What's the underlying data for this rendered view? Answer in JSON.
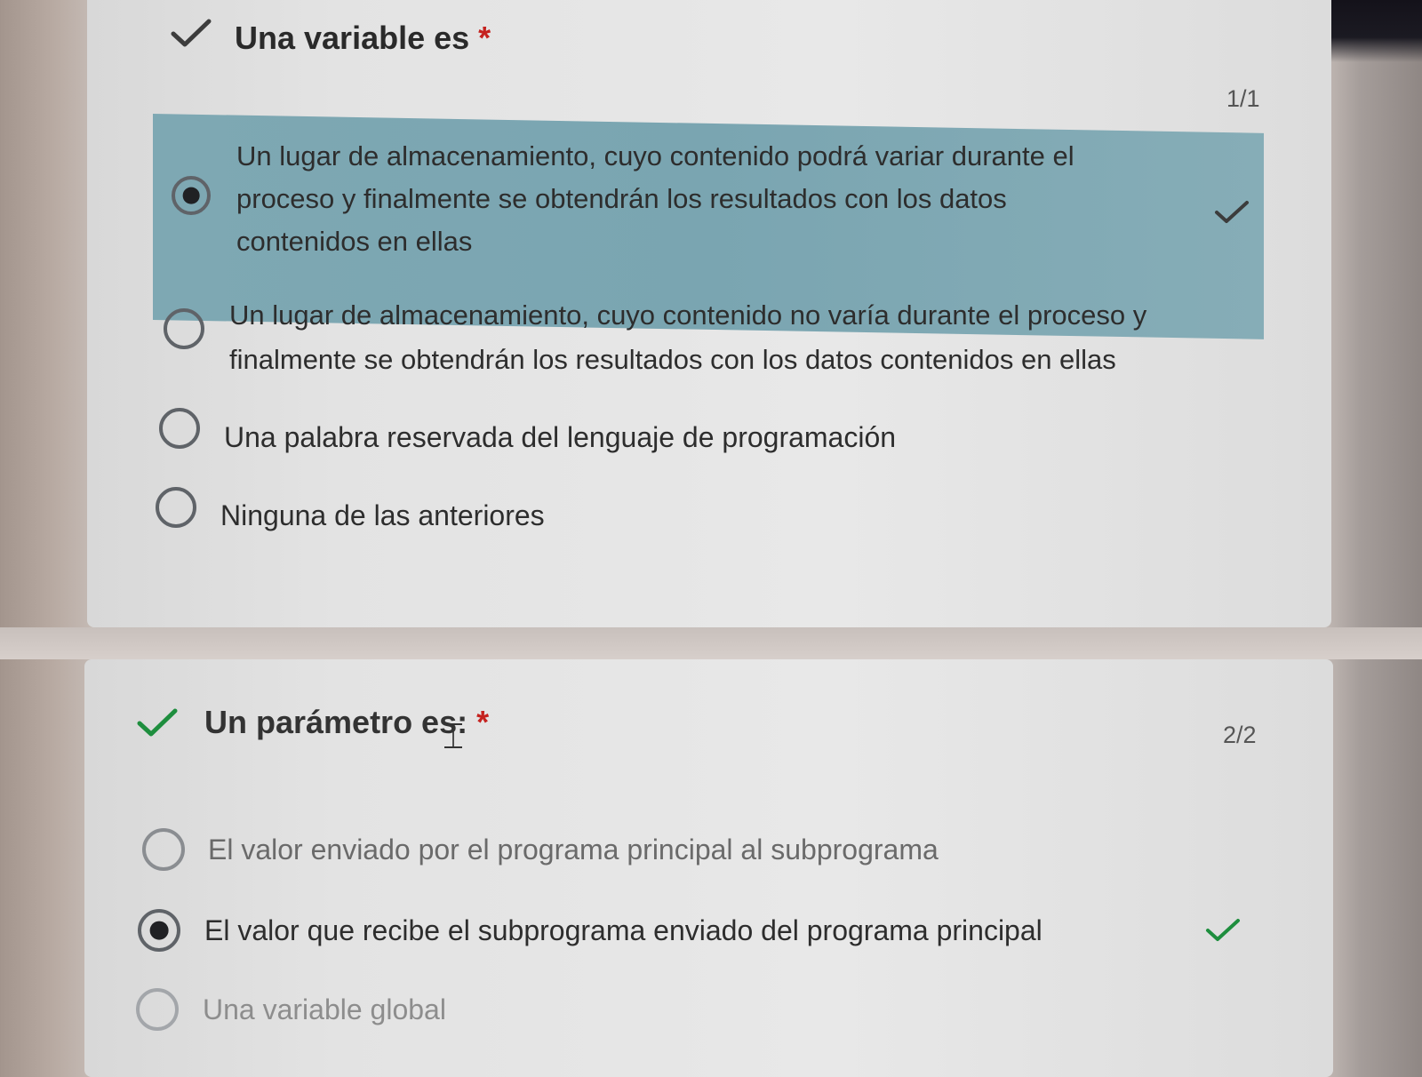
{
  "questions": [
    {
      "title": "Una variable es",
      "required_mark": "*",
      "score": "1/1",
      "options": [
        {
          "line1": "Un lugar de almacenamiento, cuyo contenido podrá variar durante el",
          "line2": "proceso y finalmente se obtendrán los resultados con los datos",
          "line3": "contenidos en ellas",
          "selected": true,
          "correct": true
        },
        {
          "line1": "Un lugar de almacenamiento, cuyo contenido no varía durante el proceso y",
          "line2": "finalmente se obtendrán los resultados con los datos contenidos en ellas",
          "selected": false
        },
        {
          "line1": "Una palabra reservada del lenguaje de programación",
          "selected": false
        },
        {
          "line1": "Ninguna de las anteriores",
          "selected": false
        }
      ]
    },
    {
      "title": "Un parámetro es:",
      "required_mark": "*",
      "score": "2/2",
      "options": [
        {
          "line1": "El valor enviado por el programa principal al subprograma",
          "selected": false
        },
        {
          "line1": "El valor que recibe el subprograma enviado del programa principal",
          "selected": true,
          "correct": true
        },
        {
          "line1": "Una variable global",
          "selected": false
        }
      ]
    }
  ],
  "colors": {
    "correct_highlight": "#7ea8b3",
    "check_dark": "#3c3c3c",
    "check_green": "#1e8e3e",
    "required": "#c5221f"
  },
  "icons": {
    "question_status": "checkmark-icon",
    "correct_answer": "checkmark-icon",
    "text_cursor": "i-beam-cursor-icon"
  }
}
